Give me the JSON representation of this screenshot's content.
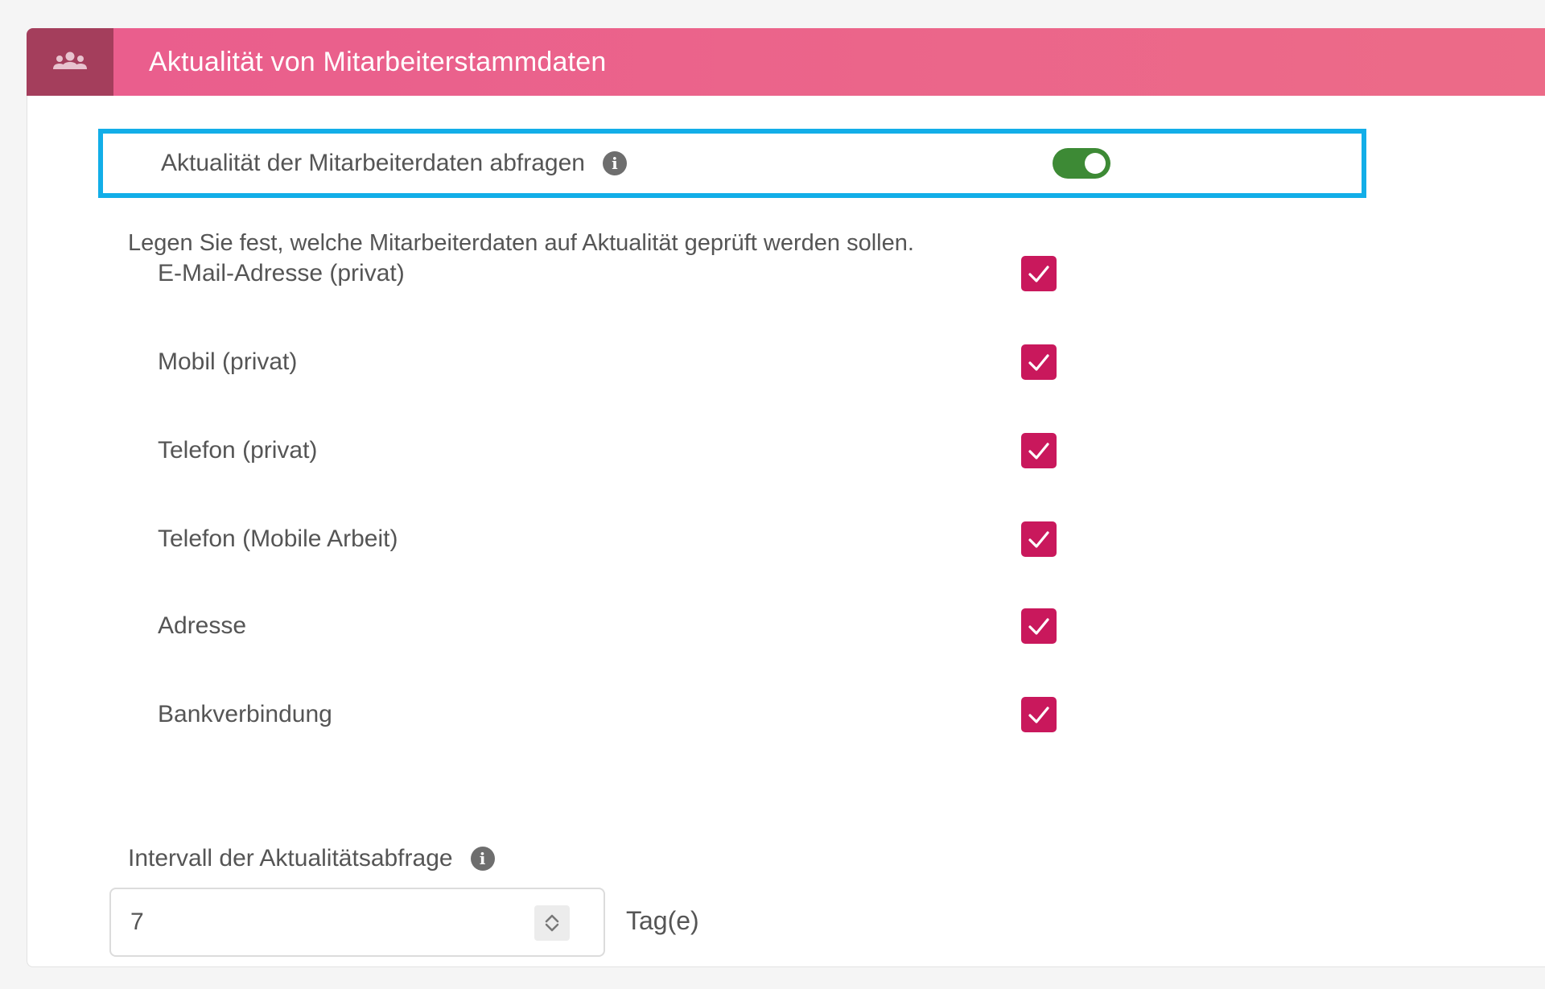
{
  "panel": {
    "title": "Aktualität von Mitarbeiterstammdaten",
    "icon": "users-group-icon",
    "header_icon_bg": "#a43e5c",
    "header_gradient": [
      "#ea5e8d",
      "#ec6b88"
    ]
  },
  "toggle": {
    "label": "Aktualität der Mitarbeiterdaten abfragen",
    "info_glyph": "i",
    "enabled": true,
    "on_color": "#3d8a35",
    "highlight_color": "#12aee8"
  },
  "description": "Legen Sie fest, welche Mitarbeiterdaten auf Aktualität geprüft werden sollen.",
  "fields": [
    {
      "label": "E-Mail-Adresse (privat)",
      "checked": true
    },
    {
      "label": "Mobil (privat)",
      "checked": true
    },
    {
      "label": "Telefon (privat)",
      "checked": true
    },
    {
      "label": "Telefon (Mobile Arbeit)",
      "checked": true
    },
    {
      "label": "Adresse",
      "checked": true
    },
    {
      "label": "Bankverbindung",
      "checked": true
    }
  ],
  "checkbox_color": "#c9185c",
  "interval": {
    "label": "Intervall der Aktualitätsabfrage",
    "info_glyph": "i",
    "value": "7",
    "unit": "Tag(e)"
  }
}
